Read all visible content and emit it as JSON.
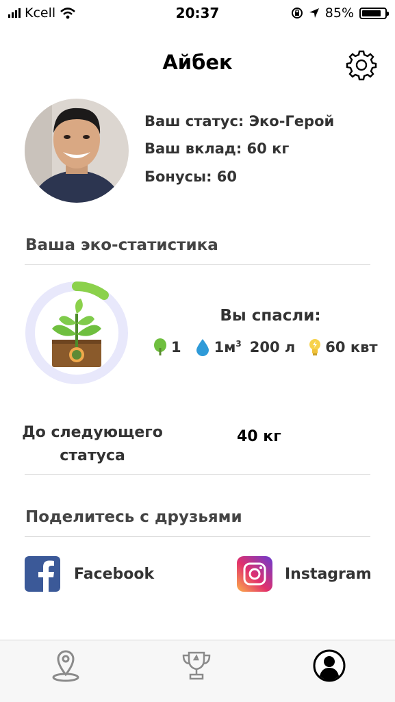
{
  "status_bar": {
    "carrier": "Kcell",
    "time": "20:37",
    "battery": "85%"
  },
  "header": {
    "title": "Айбек"
  },
  "profile": {
    "status": "Ваш статус: Эко-Герой",
    "contribution": "Ваш вклад: 60 кг",
    "bonuses": "Бонусы: 60"
  },
  "eco_stats": {
    "section_title": "Ваша эко-статистика",
    "saved_title": "Вы спасли:",
    "trees": "1",
    "water_m3": "1м",
    "water_m3_sup": "3",
    "water_l": "200 л",
    "energy": "60 квт",
    "progress": 0.1,
    "next_status_label": "До следующего статуса",
    "next_status_value": "40 кг"
  },
  "share": {
    "section_title": "Поделитесь с друзьями",
    "facebook": "Facebook",
    "instagram": "Instagram"
  },
  "tabs": [
    {
      "icon": "map-pin-icon"
    },
    {
      "icon": "trophy-icon"
    },
    {
      "icon": "profile-icon",
      "active": true
    }
  ],
  "colors": {
    "progress_track": "#e8e8fb",
    "progress_fill": "#8bd14b",
    "facebook": "#3b5998",
    "water": "#2e9ad8",
    "leaf": "#6fbf3f"
  }
}
